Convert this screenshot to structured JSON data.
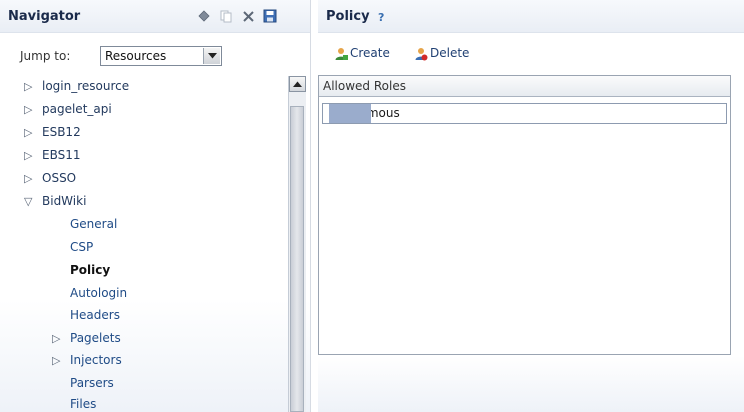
{
  "navigator": {
    "title": "Navigator",
    "jump_label": "Jump to:",
    "jump_value": "Resources",
    "tree": [
      {
        "label": "login_resource",
        "expander": "▷",
        "level": 0
      },
      {
        "label": "pagelet_api",
        "expander": "▷",
        "level": 0
      },
      {
        "label": "ESB12",
        "expander": "▷",
        "level": 0
      },
      {
        "label": "EBS11",
        "expander": "▷",
        "level": 0
      },
      {
        "label": "OSSO",
        "expander": "▷",
        "level": 0
      },
      {
        "label": "BidWiki",
        "expander": "▽",
        "level": 0
      },
      {
        "label": "General",
        "expander": "",
        "level": 2
      },
      {
        "label": "CSP",
        "expander": "",
        "level": 2
      },
      {
        "label": "Policy",
        "expander": "",
        "level": 2,
        "selected": true
      },
      {
        "label": "Autologin",
        "expander": "",
        "level": 2
      },
      {
        "label": "Headers",
        "expander": "",
        "level": 2
      },
      {
        "label": "Pagelets",
        "expander": "▷",
        "level": 1
      },
      {
        "label": "Injectors",
        "expander": "▷",
        "level": 1
      },
      {
        "label": "Parsers",
        "expander": "",
        "level": 2
      },
      {
        "label": "Files",
        "expander": "",
        "level": 2
      }
    ]
  },
  "policy": {
    "title": "Policy",
    "help": "?",
    "create_label": "Create",
    "delete_label": "Delete",
    "table": {
      "header": "Allowed Roles",
      "rows": [
        "Anonymous"
      ]
    }
  },
  "icons": {
    "tools": [
      "diamond-icon",
      "copy-icon",
      "scissors-icon",
      "save-icon"
    ],
    "create": "create-role-icon",
    "delete": "delete-role-icon"
  },
  "colors": {
    "link": "#1f4b86",
    "selection_tail": "#9aaccc",
    "header_bg": "#e9eef5"
  }
}
